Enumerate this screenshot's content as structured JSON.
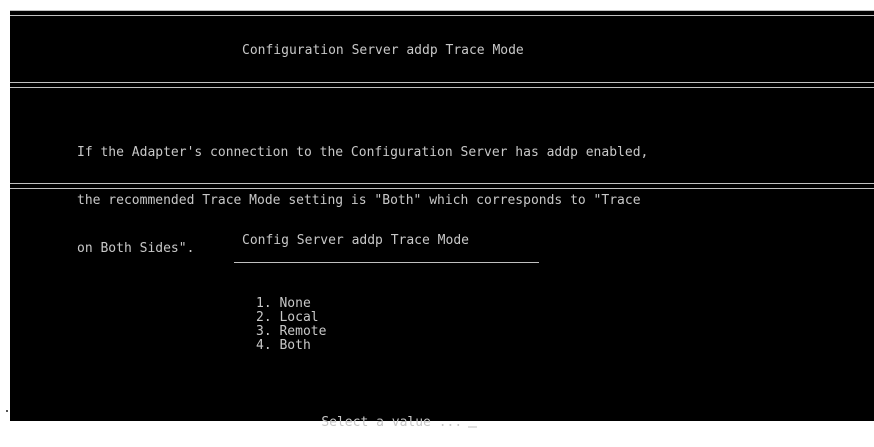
{
  "header": {
    "title": "Configuration Server addp Trace Mode"
  },
  "description": {
    "lines": [
      "If the Adapter's connection to the Configuration Server has addp enabled,",
      "the recommended Trace Mode setting is \"Both\" which corresponds to \"Trace",
      "on Both Sides\"."
    ]
  },
  "menu": {
    "title": "Config Server addp Trace Mode",
    "options": [
      "1. None",
      "2. Local",
      "3. Remote",
      "4. Both"
    ]
  },
  "prompt": {
    "text": "Select a value ..."
  },
  "colors": {
    "background": "#000000",
    "text": "#c8c8c8",
    "rule": "#c0c0c0"
  }
}
